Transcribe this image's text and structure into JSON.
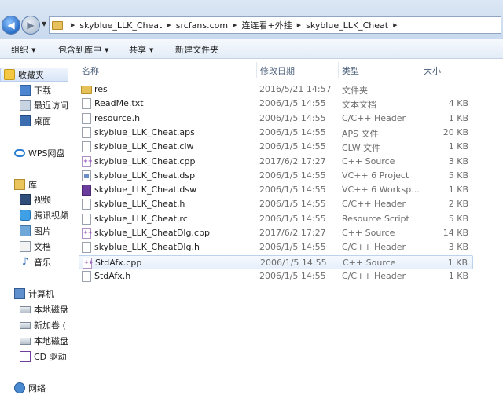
{
  "address": {
    "crumbs": [
      "skyblue_LLK_Cheat",
      "srcfans.com",
      "连连看+外挂",
      "skyblue_LLK_Cheat"
    ]
  },
  "toolbar": {
    "organize": "组织",
    "include_in_library": "包含到库中",
    "share": "共享",
    "new_folder": "新建文件夹"
  },
  "sidebar": {
    "favorites": "收藏夹",
    "downloads": "下载",
    "recent": "最近访问",
    "desktop": "桌面",
    "wps": "WPS网盘",
    "libraries": "库",
    "videos": "视频",
    "tencent_video": "腾讯视频",
    "pictures": "图片",
    "documents": "文档",
    "music": "音乐",
    "computer": "计算机",
    "local_disk_c": "本地磁盘",
    "new_volume": "新加卷 (",
    "local_disk_e": "本地磁盘",
    "cd_drive": "CD 驱动",
    "network": "网络"
  },
  "columns": {
    "name": "名称",
    "date": "修改日期",
    "type": "类型",
    "size": "大小"
  },
  "files": [
    {
      "name": "res",
      "date": "2016/5/21 14:57",
      "type": "文件夹",
      "size": "",
      "icon": "folder"
    },
    {
      "name": "ReadMe.txt",
      "date": "2006/1/5 14:55",
      "type": "文本文档",
      "size": "4 KB",
      "icon": "doc"
    },
    {
      "name": "resource.h",
      "date": "2006/1/5 14:55",
      "type": "C/C++ Header",
      "size": "1 KB",
      "icon": "h"
    },
    {
      "name": "skyblue_LLK_Cheat.aps",
      "date": "2006/1/5 14:55",
      "type": "APS 文件",
      "size": "20 KB",
      "icon": "doc"
    },
    {
      "name": "skyblue_LLK_Cheat.clw",
      "date": "2006/1/5 14:55",
      "type": "CLW 文件",
      "size": "1 KB",
      "icon": "doc"
    },
    {
      "name": "skyblue_LLK_Cheat.cpp",
      "date": "2017/6/2 17:27",
      "type": "C++ Source",
      "size": "3 KB",
      "icon": "cpp"
    },
    {
      "name": "skyblue_LLK_Cheat.dsp",
      "date": "2006/1/5 14:55",
      "type": "VC++ 6 Project",
      "size": "5 KB",
      "icon": "proj"
    },
    {
      "name": "skyblue_LLK_Cheat.dsw",
      "date": "2006/1/5 14:55",
      "type": "VC++ 6 Worksp...",
      "size": "1 KB",
      "icon": "dsw"
    },
    {
      "name": "skyblue_LLK_Cheat.h",
      "date": "2006/1/5 14:55",
      "type": "C/C++ Header",
      "size": "2 KB",
      "icon": "h"
    },
    {
      "name": "skyblue_LLK_Cheat.rc",
      "date": "2006/1/5 14:55",
      "type": "Resource Script",
      "size": "5 KB",
      "icon": "doc"
    },
    {
      "name": "skyblue_LLK_CheatDlg.cpp",
      "date": "2017/6/2 17:27",
      "type": "C++ Source",
      "size": "14 KB",
      "icon": "cpp"
    },
    {
      "name": "skyblue_LLK_CheatDlg.h",
      "date": "2006/1/5 14:55",
      "type": "C/C++ Header",
      "size": "3 KB",
      "icon": "h"
    },
    {
      "name": "StdAfx.cpp",
      "date": "2006/1/5 14:55",
      "type": "C++ Source",
      "size": "1 KB",
      "icon": "cpp",
      "selected": true
    },
    {
      "name": "StdAfx.h",
      "date": "2006/1/5 14:55",
      "type": "C/C++ Header",
      "size": "1 KB",
      "icon": "h"
    }
  ]
}
